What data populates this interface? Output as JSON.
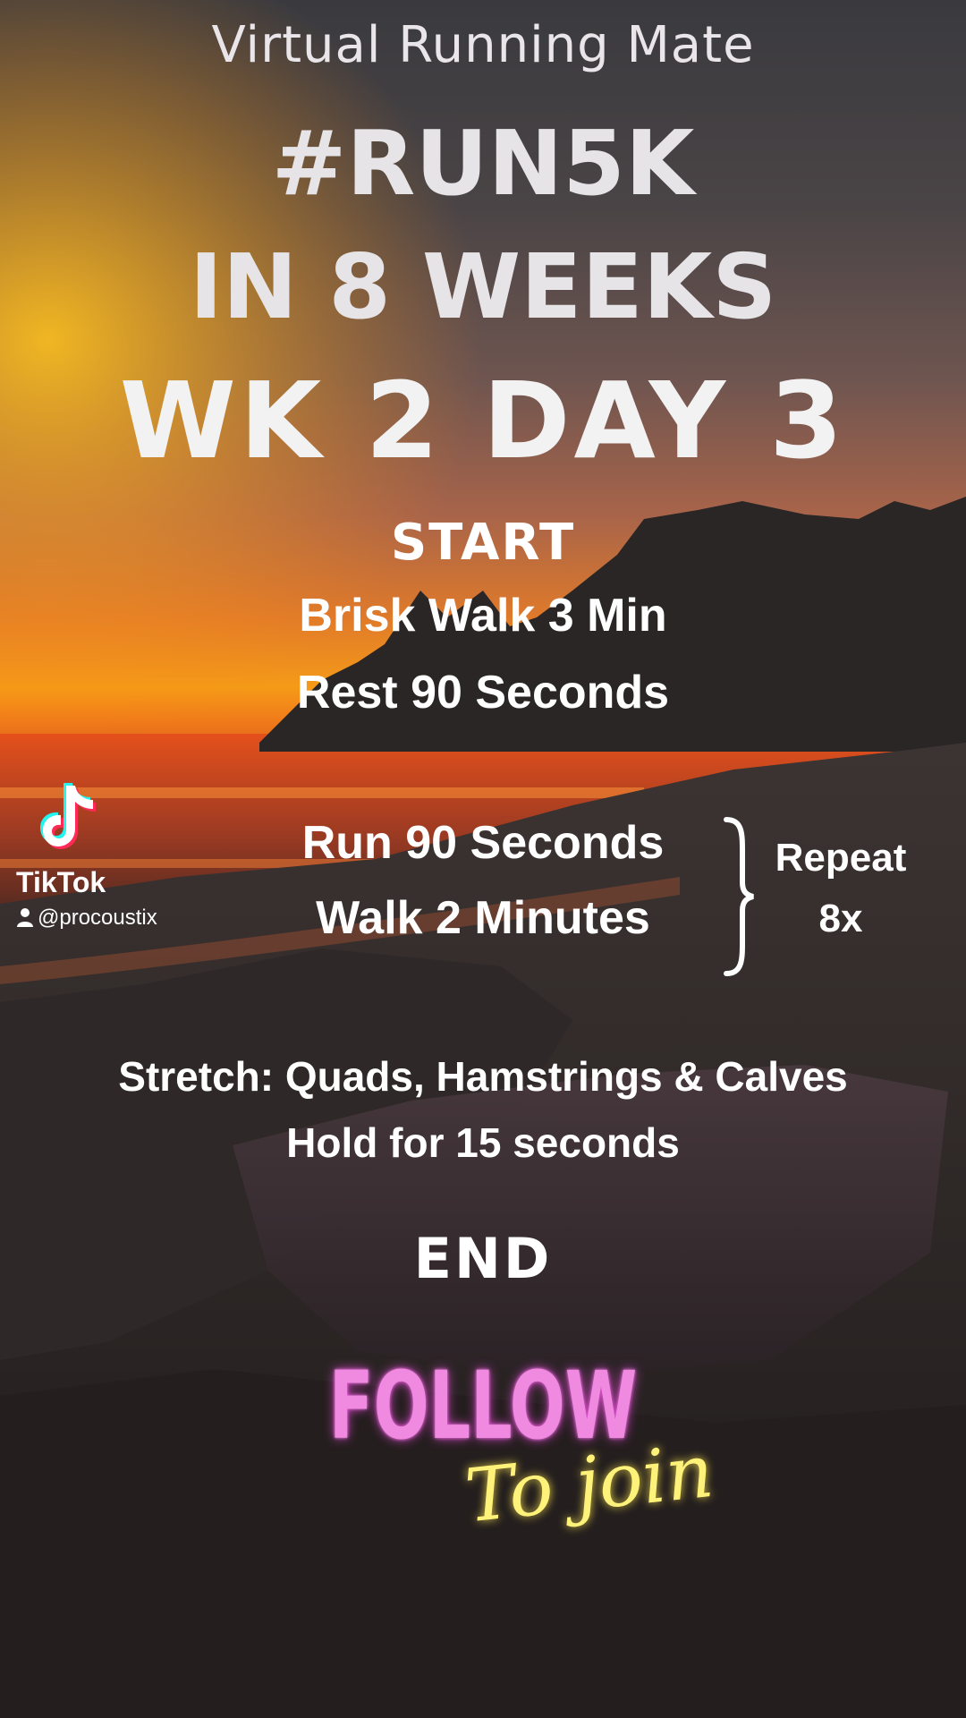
{
  "header": {
    "subtitle": "Virtual Running Mate",
    "hashtag": "#RUN5K",
    "goal": "IN 8 WEEKS",
    "session": "WK 2 DAY 3"
  },
  "workout": {
    "start_label": "START",
    "warmup": [
      "Brisk Walk 3 Min",
      "Rest 90 Seconds"
    ],
    "intervals": [
      "Run 90 Seconds",
      "Walk 2 Minutes"
    ],
    "repeat_label": "Repeat",
    "repeat_count": "8x",
    "cooldown": [
      "Stretch: Quads, Hamstrings & Calves",
      "Hold for 15 seconds"
    ],
    "end_label": "END"
  },
  "cta": {
    "follow": "FOLLOW",
    "join": "To join"
  },
  "watermark": {
    "brand": "TikTok",
    "handle": "@procoustix",
    "icon": "tiktok-logo-icon"
  },
  "colors": {
    "follow_pink": "#f08ae0",
    "join_yellow": "#fff27a",
    "sunset_orange": "#f5a017"
  }
}
